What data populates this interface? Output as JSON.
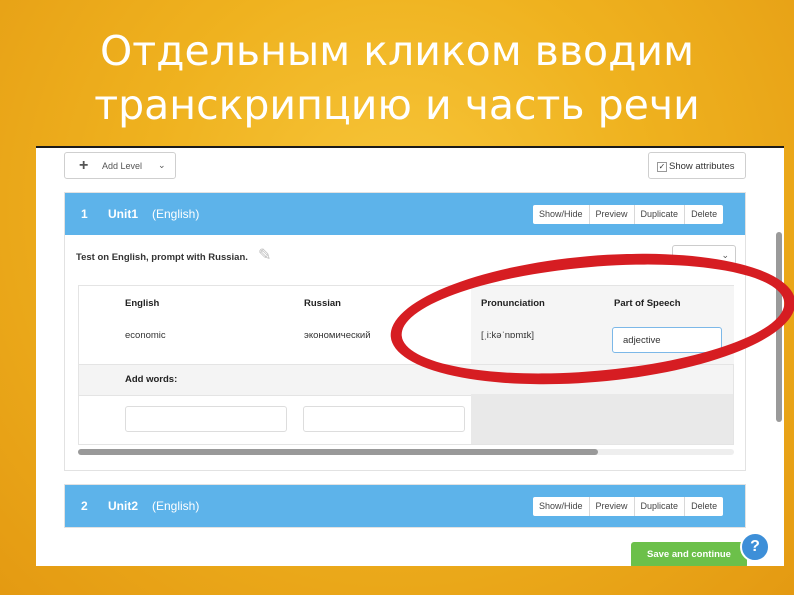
{
  "slide": {
    "title_line1": "Отдельным кликом вводим",
    "title_line2": "транскрипцию и часть речи"
  },
  "toolbar": {
    "add_level_label": "Add Level",
    "show_attributes_label": "Show attributes",
    "show_attributes_checked": "✓"
  },
  "units": [
    {
      "number": "1",
      "name": "Unit1",
      "language": "(English)",
      "actions": [
        "Show/Hide",
        "Preview",
        "Duplicate",
        "Delete"
      ],
      "prompt": "Test on English, prompt with Russian.",
      "columns": [
        "English",
        "Russian",
        "Pronunciation",
        "Part of Speech"
      ],
      "rows": [
        {
          "english": "economic",
          "russian": "экономический",
          "pronunciation": "[ˌi:kəˈnɒmɪk]",
          "part_of_speech": "adjective"
        }
      ],
      "add_words_label": "Add words:"
    },
    {
      "number": "2",
      "name": "Unit2",
      "language": "(English)",
      "actions": [
        "Show/Hide",
        "Preview",
        "Duplicate",
        "Delete"
      ]
    }
  ],
  "footer": {
    "save_label": "Save and continue",
    "help_label": "?"
  },
  "colors": {
    "unit_header": "#5db3ea",
    "save_button": "#6cc04a",
    "highlight": "#d61d22",
    "background": "#efb21f"
  }
}
